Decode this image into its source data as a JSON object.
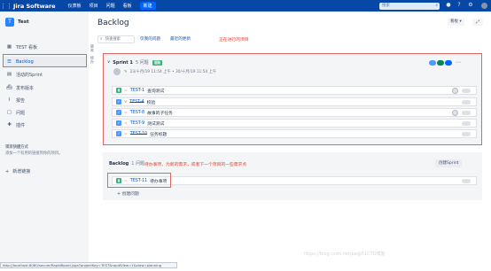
{
  "topbar": {
    "logo": "Jira Software",
    "menus": [
      "仪表板",
      "项目",
      "问题",
      "看板"
    ],
    "create": "新建",
    "search_placeholder": "搜索"
  },
  "sidebar": {
    "project_name": "Test",
    "project_initial": "T",
    "items": [
      {
        "label": "TEST 看板",
        "icon": "board-icon"
      },
      {
        "label": "Backlog",
        "icon": "backlog-icon"
      },
      {
        "label": "活动的Sprint",
        "icon": "sprint-icon"
      },
      {
        "label": "发布版本",
        "icon": "release-icon"
      },
      {
        "label": "报告",
        "icon": "report-icon"
      },
      {
        "label": "问题",
        "icon": "issues-icon"
      },
      {
        "label": "插件",
        "icon": "addon-icon"
      }
    ],
    "hint_title": "项目快捷方式",
    "hint_text": "添加一个有用的链接到你的项目。",
    "add_link": "新增链接"
  },
  "vertical_tabs": [
    "版本",
    "经办"
  ],
  "main": {
    "title": "Backlog",
    "board_button": "看板",
    "search_placeholder": "快速搜索",
    "quick_filters": [
      "仅我的问题",
      "最近的更新"
    ],
    "annotation_sprint": "正在进行的项目",
    "annotation_backlog": "待办事项，为新的需求，或者下一个项目的一些需求点",
    "sprint": {
      "name": "Sprint 1",
      "count": "5 问题",
      "badge": "活跃",
      "dates": "23/十月/19 11:54 上午 • 30/十月/19 11:54 上午",
      "issues": [
        {
          "key": "TEST-1",
          "summary": "查询测试",
          "type_color": "#36b37e",
          "done": false
        },
        {
          "key": "TEST-4",
          "summary": "校验",
          "type_color": "#4c9aff",
          "done": true
        },
        {
          "key": "TEST-8",
          "summary": "故事的子任务",
          "type_color": "#4c9aff",
          "done": false
        },
        {
          "key": "TEST-9",
          "summary": "测试测试",
          "type_color": "#4c9aff",
          "done": false
        },
        {
          "key": "TEST-10",
          "summary": "任务标题",
          "type_color": "#4c9aff",
          "done": true
        }
      ]
    },
    "backlog": {
      "title": "Backlog",
      "count": "1 问题",
      "create_sprint": "创建Sprint",
      "issue": {
        "key": "TEST-11",
        "summary": "待办事项",
        "type_color": "#36b37e"
      },
      "create_issue": "创建问题"
    }
  },
  "status_url": "http://localhost:8080/secure/RapidBoard.jspa?projectKey=TEST&rapidView=1&view=planning",
  "watermark": "https://blog.csdn.net/pa@51CTO博客",
  "colors": {
    "topbar": "#0747a6",
    "accent": "#0052cc",
    "annotation": "#e8402b",
    "dots": [
      "#4c9aff",
      "#00875a",
      "#0065ff"
    ]
  }
}
